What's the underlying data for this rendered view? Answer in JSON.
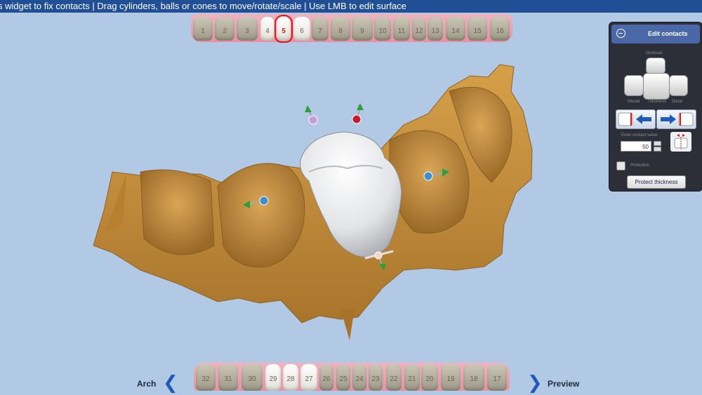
{
  "topbar": {
    "instruction": "s widget to fix contacts | Drag cylinders, balls or cones to move/rotate/scale | Use LMB to edit surface"
  },
  "upper_teeth": [
    "1",
    "2",
    "3",
    "4",
    "5",
    "6",
    "7",
    "8",
    "9",
    "10",
    "11",
    "12",
    "13",
    "14",
    "15",
    "16"
  ],
  "selected_tooth": "5",
  "lower_teeth": [
    "32",
    "31",
    "30",
    "29",
    "28",
    "27",
    "26",
    "25",
    "24",
    "23",
    "22",
    "21",
    "20",
    "19",
    "18",
    "17"
  ],
  "nav": {
    "prev_label": "Arch",
    "next_label": "Preview",
    "prev_icon": "chevron-left-icon",
    "next_icon": "chevron-right-icon"
  },
  "panel": {
    "title": "Edit contacts",
    "view_labels": {
      "occlusal": "Occlusal",
      "mesial": "Mesial",
      "thickness": "Thickness",
      "distal": "Distal"
    },
    "contact_label": "Enter contact value",
    "contact_value": "50",
    "protection_label": "Protection",
    "protection_checked": false,
    "protect_button": "Protect thickness"
  },
  "colors": {
    "background": "#b2c9e5",
    "topbar": "#204f95",
    "gum": "#c48d3a",
    "crown": "#e8e8ea",
    "accent_red": "#e0161b",
    "arrow_blue": "#1f5ab8"
  }
}
